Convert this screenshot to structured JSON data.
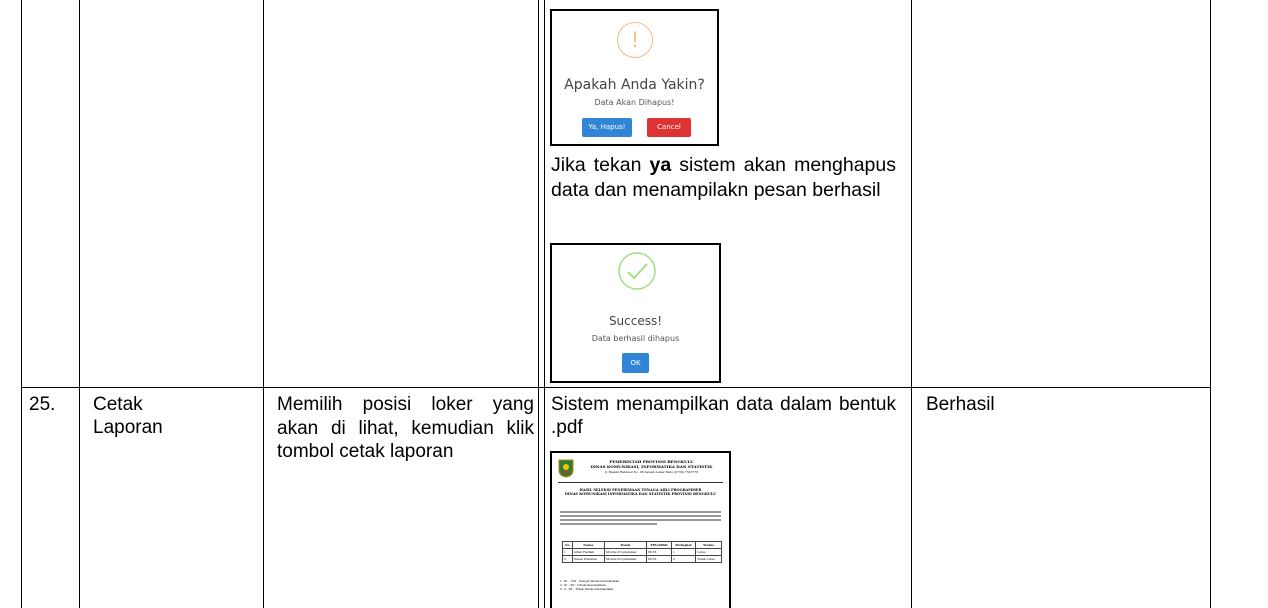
{
  "rows": [
    {
      "no": "",
      "feature": "",
      "action": "",
      "confirm_dialog": {
        "icon": "!",
        "title": "Apakah Anda Yakin?",
        "message": "Data Akan Dihapus!",
        "confirm_label": "Ya, Hapus!",
        "cancel_label": "Cancel",
        "warn_color": "#f8bb86",
        "confirm_color": "#3085d6",
        "cancel_color": "#d33"
      },
      "desc_prefix": "Jika tekan ",
      "desc_bold": "ya",
      "desc_suffix": " sistem akan menghapus data dan menampilakn pesan berhasil",
      "success_dialog": {
        "title": "Success!",
        "message": "Data berhasil dihapus",
        "ok_label": "OK",
        "success_color": "#a5dc86"
      },
      "result": ""
    },
    {
      "no": "25.",
      "feature": "Cetak Laporan",
      "action": "Memilih posisi loker yang akan di lihat, kemudian klik tombol cetak laporan",
      "expected": "Sistem menampilkan data dalam bentuk .pdf",
      "result": "Berhasil",
      "pdf_preview": {
        "header_1": "PEMERINTAH PROVINSI BENGKULU",
        "header_2": "DINAS KOMUNIKASI, INFORMATIKA DAN STATISTIK",
        "header_3": "Jl. Basuki Rahmad No. 06 Sawah Lebar Baru (0736) 7323776",
        "title_1": "HASIL SELEKSI PENERIMAAN TENAGA AHLI PROGRAMMER",
        "title_2": "DINAS KOMUNIKASI INFORMATIKA DAN STATISTIK PROVINSI BENGKULU",
        "columns": [
          "No",
          "Nama",
          "Posisi",
          "TPA/ABSD",
          "Peringkat",
          "Status"
        ],
        "table_rows": [
          [
            "1",
            "Arfan Fadilah",
            "Mobile Programmer",
            "88.33",
            "1",
            "Lulus"
          ],
          [
            "2",
            "Yunan Pratama",
            "Mobile Programmer",
            "80.33",
            "2",
            "Tidak Lulus"
          ]
        ],
        "notes": [
          "1. 81 - 100 : Sangat Direkomendasikan",
          "2. 61 - 80 : Direkomendasikan",
          "3. 0 - 60 : Tidak Direkomendasikan"
        ]
      }
    }
  ]
}
